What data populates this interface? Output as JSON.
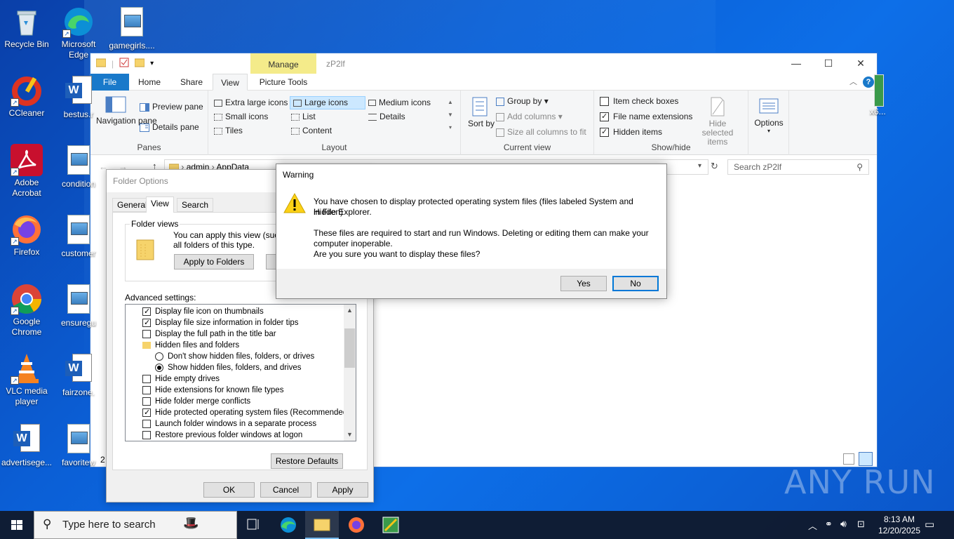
{
  "desktop": {
    "icons_col1": [
      "Recycle Bin",
      "CCleaner",
      "Adobe Acrobat",
      "Firefox",
      "Google Chrome",
      "VLC media player",
      "advertisege..."
    ],
    "icons_col2": [
      "Microsoft Edge",
      "bestus.r",
      "condition",
      "customer",
      "ensuregu",
      "fairzone.",
      "favoritew"
    ],
    "top_file": "gamegirls....",
    "partial_right": "x6..."
  },
  "explorer": {
    "title": "zP2lf",
    "context_tab": "Manage",
    "tabs": [
      "File",
      "Home",
      "Share",
      "View",
      "Picture Tools"
    ],
    "panes": {
      "nav": "Navigation pane",
      "preview": "Preview pane",
      "details": "Details pane",
      "group": "Panes"
    },
    "layout": {
      "items": [
        "Extra large icons",
        "Large icons",
        "Medium icons",
        "Small icons",
        "List",
        "Details",
        "Tiles",
        "Content"
      ],
      "group": "Layout"
    },
    "current_view": {
      "sort": "Sort by",
      "group_by": "Group by",
      "add_columns": "Add columns",
      "size_cols": "Size all columns to fit",
      "group": "Current view"
    },
    "show_hide": {
      "item_checkboxes": "Item check boxes",
      "file_ext": "File name extensions",
      "hidden_items": "Hidden items",
      "hide_selected": "Hide selected items",
      "group": "Show/hide"
    },
    "options": "Options",
    "address": {
      "parts": [
        "admin",
        "AppData"
      ]
    },
    "search_placeholder": "Search zP2lf",
    "status_count": "2"
  },
  "folder_options": {
    "title": "Folder Options",
    "tabs": [
      "General",
      "View",
      "Search"
    ],
    "folder_views_label": "Folder views",
    "folder_views_text1": "You can apply this view (such a",
    "folder_views_text2": "all folders of this type.",
    "apply_to_folders": "Apply to Folders",
    "advanced_label": "Advanced settings:",
    "advanced_items": [
      {
        "text": "Display file icon on thumbnails",
        "kind": "check",
        "on": true
      },
      {
        "text": "Display file size information in folder tips",
        "kind": "check",
        "on": true
      },
      {
        "text": "Display the full path in the title bar",
        "kind": "check",
        "on": false
      },
      {
        "text": "Hidden files and folders",
        "kind": "folder",
        "on": false
      },
      {
        "text": "Don't show hidden files, folders, or drives",
        "kind": "radio",
        "on": false
      },
      {
        "text": "Show hidden files, folders, and drives",
        "kind": "radio",
        "on": true
      },
      {
        "text": "Hide empty drives",
        "kind": "check",
        "on": false
      },
      {
        "text": "Hide extensions for known file types",
        "kind": "check",
        "on": false
      },
      {
        "text": "Hide folder merge conflicts",
        "kind": "check",
        "on": false
      },
      {
        "text": "Hide protected operating system files (Recommended)",
        "kind": "check",
        "on": true
      },
      {
        "text": "Launch folder windows in a separate process",
        "kind": "check",
        "on": false
      },
      {
        "text": "Restore previous folder windows at logon",
        "kind": "check",
        "on": false
      }
    ],
    "restore_defaults": "Restore Defaults",
    "ok": "OK",
    "cancel": "Cancel",
    "apply": "Apply"
  },
  "warning": {
    "title": "Warning",
    "line1": "You have chosen to display protected operating system files (files labeled System and Hidden)",
    "line2": "in File Explorer.",
    "line3": "These files are required to start and run Windows. Deleting or editing them can make your",
    "line4": "computer inoperable.",
    "line5": "Are you sure you want to display these files?",
    "yes": "Yes",
    "no": "No"
  },
  "taskbar": {
    "search_placeholder": "Type here to search",
    "time": "8:13 AM",
    "date": "12/20/2025"
  },
  "watermark": "ANY RUN"
}
